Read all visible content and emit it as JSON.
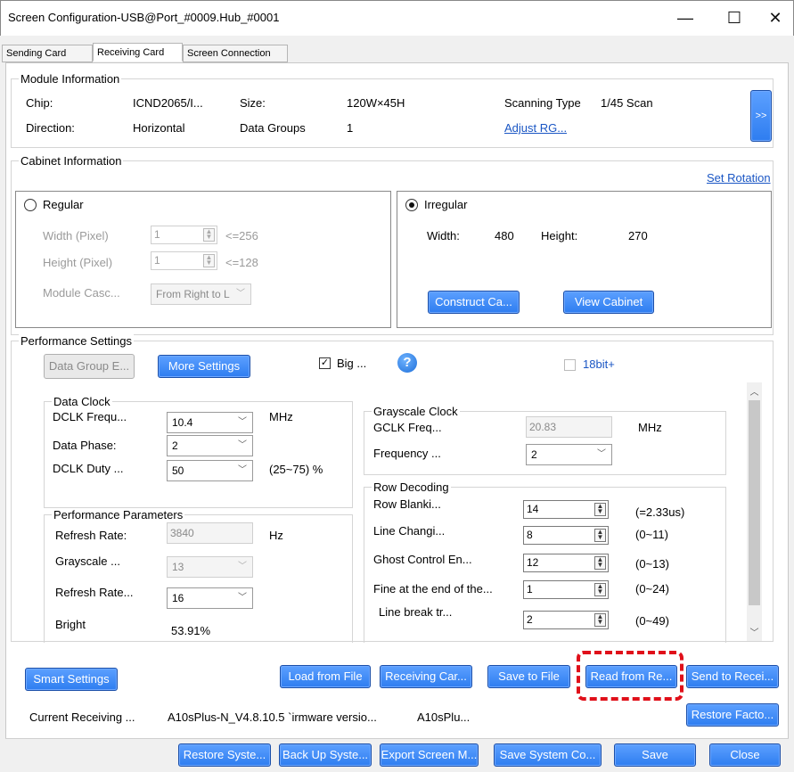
{
  "window": {
    "title": "Screen Configuration-USB@Port_#0009.Hub_#0001",
    "minimize": "—",
    "maximize": "☐",
    "close": "✕"
  },
  "tabs": [
    "Sending Card",
    "Receiving Card",
    "Screen Connection"
  ],
  "module": {
    "label": "Module Information",
    "chip_label": "Chip:",
    "chip_value": "ICND2065/I...",
    "size_label": "Size:",
    "size_value": "120W×45H",
    "scan_label": "Scanning Type",
    "scan_value": "1/45 Scan",
    "direction_label": "Direction:",
    "direction_value": "Horizontal",
    "groups_label": "Data Groups",
    "groups_value": "1",
    "adjust_link": "Adjust RG...",
    "more_btn": ">>"
  },
  "cabinet": {
    "label": "Cabinet Information",
    "set_rotation": "Set Rotation",
    "regular_label": "Regular",
    "width_label": "Width (Pixel)",
    "width_value": "1",
    "width_limit": "<=256",
    "height_label": "Height (Pixel)",
    "height_value": "1",
    "height_limit": "<=128",
    "cascade_label": "Module Casc...",
    "cascade_value": "From Right to L",
    "irregular_label": "Irregular",
    "irr_width_label": "Width:",
    "irr_width_value": "480",
    "irr_height_label": "Height:",
    "irr_height_value": "270",
    "construct_btn": "Construct Ca...",
    "view_btn": "View Cabinet"
  },
  "performance": {
    "label": "Performance Settings",
    "data_group_btn": "Data Group E...",
    "more_settings_btn": "More Settings",
    "big_label": "Big ...",
    "help_icon": "?",
    "bit18_label": "18bit+",
    "data_clock": {
      "label": "Data Clock",
      "dclk_freq_label": "DCLK Frequ...",
      "dclk_freq_value": "10.4",
      "dclk_unit": "MHz",
      "phase_label": "Data Phase:",
      "phase_value": "2",
      "duty_label": "DCLK Duty ...",
      "duty_value": "50",
      "duty_range": "(25~75) %"
    },
    "params": {
      "label": "Performance Parameters",
      "refresh_label": "Refresh Rate:",
      "refresh_value": "3840",
      "refresh_unit": "Hz",
      "grayscale_label": "Grayscale ...",
      "grayscale_value": "13",
      "refresh_mult_label": "Refresh Rate...",
      "refresh_mult_value": "16",
      "bright_label": "Bright",
      "bright_value": "53.91%"
    },
    "gray_clock": {
      "label": "Grayscale Clock",
      "gclk_label": "GCLK Freq...",
      "gclk_value": "20.83",
      "gclk_unit": "MHz",
      "freq_label": "Frequency ...",
      "freq_value": "2"
    },
    "row_decoding": {
      "label": "Row Decoding",
      "rows": [
        {
          "label": "Row Blanki...",
          "value": "14",
          "range": "(=2.33us)"
        },
        {
          "label": "Line Changi...",
          "value": "8",
          "range": "(0~11)"
        },
        {
          "label": "Ghost Control En...",
          "value": "12",
          "range": "(0~13)"
        },
        {
          "label": "Fine at the end of the...",
          "value": "1",
          "range": "(0~24)"
        },
        {
          "label": "Line break tr...",
          "value": "2",
          "range": "(0~49)"
        }
      ]
    }
  },
  "actions": {
    "smart": "Smart Settings",
    "load": "Load from File",
    "receiving": "Receiving Car...",
    "save_file": "Save to File",
    "read": "Read from Re...",
    "send": "Send to Recei...",
    "restore_factory": "Restore Facto..."
  },
  "current": {
    "label": "Current Receiving ...",
    "value1": "A10sPlus-N_V4.8.10.5 `irmware versio...",
    "value2": "A10sPlu..."
  },
  "bottom": {
    "restore": "Restore Syste...",
    "backup": "Back Up Syste...",
    "export": "Export Screen M...",
    "save_sys": "Save System Co...",
    "save": "Save",
    "close": "Close"
  },
  "colors": {
    "button_blue": "#2e7df0",
    "link": "#1a56c4",
    "highlight": "#e0101a"
  }
}
